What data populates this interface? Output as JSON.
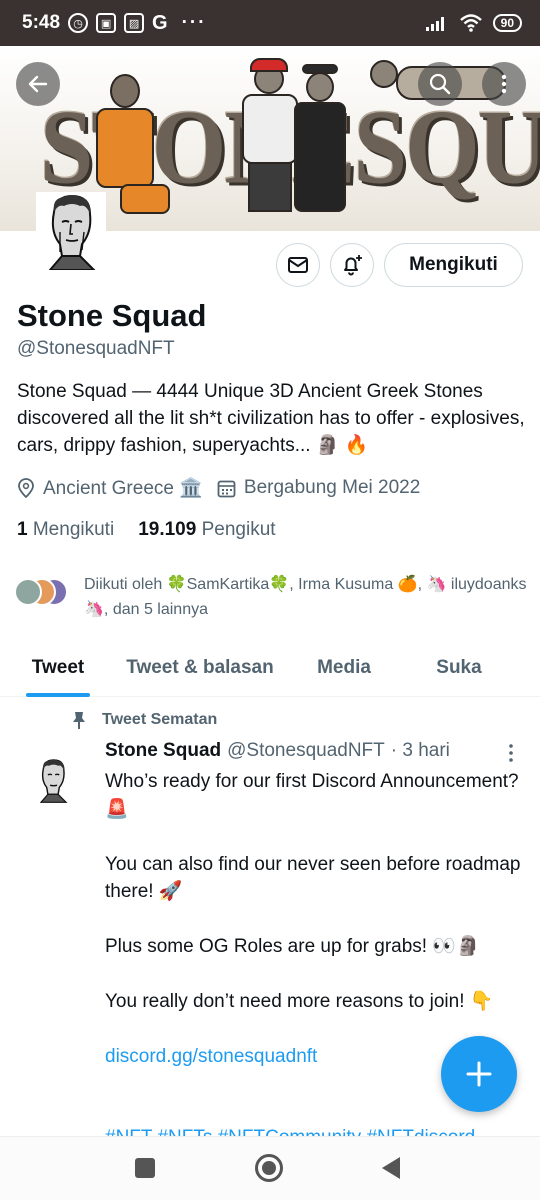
{
  "status_bar": {
    "time": "5:48",
    "battery": "90",
    "overflow": "···"
  },
  "banner": {
    "text": "STONESQUAD"
  },
  "profile": {
    "name": "Stone Squad",
    "handle": "@StonesquadNFT",
    "bio": "Stone Squad — 4444 Unique 3D Ancient Greek Stones discovered all the lit sh*t civilization has to offer - explosives, cars, drippy fashion, superyachts... 🗿 🔥",
    "location": "Ancient Greece 🏛️",
    "joined": "Bergabung Mei 2022",
    "following_count": "1",
    "following_label": "Mengikuti",
    "followers_count": "19.109",
    "followers_label": "Pengikut",
    "followed_by": "Diikuti oleh 🍀SamKartika🍀, Irma Kusuma 🍊, 🦄 iluydoanks 🦄, dan 5 lainnya",
    "follow_button_label": "Mengikuti"
  },
  "tabs": [
    {
      "label": "Tweet",
      "active": true
    },
    {
      "label": "Tweet & balasan",
      "active": false
    },
    {
      "label": "Media",
      "active": false
    },
    {
      "label": "Suka",
      "active": false
    }
  ],
  "tweet": {
    "pinned_label": "Tweet Sematan",
    "author": "Stone Squad",
    "handle": "@StonesquadNFT",
    "time": "· 3 hari",
    "line1": "Who’s ready for our first Discord Announcement? 🚨",
    "line2": "You can also find our never seen before roadmap there! 🚀",
    "line3": "Plus some OG Roles are up for grabs! 👀🗿",
    "line4": "You really don’t need more reasons to join! 👇",
    "link": "discord.gg/stonesquadnft",
    "hashtags": "#NFT #NFTs #NFTCommunity #NFTdiscord"
  },
  "colors": {
    "accent": "#1d9bf0",
    "text": "#0f1419",
    "secondary": "#536471"
  }
}
